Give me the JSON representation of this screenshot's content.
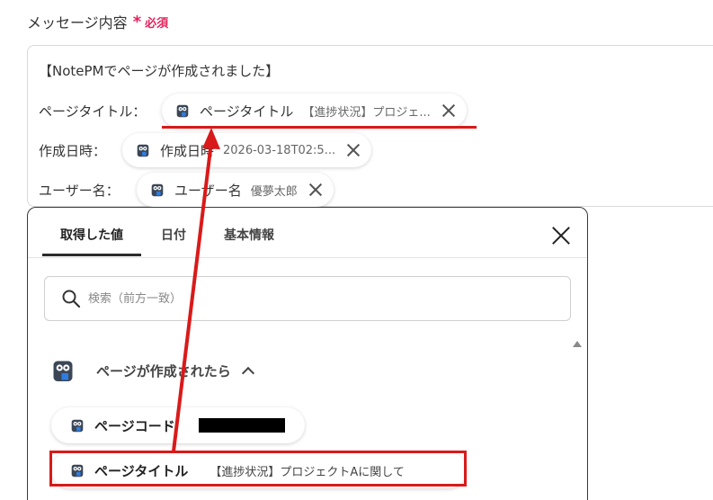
{
  "field": {
    "label": "メッセージ内容",
    "required_star": "*",
    "required_text": "必須"
  },
  "message": {
    "line1": "【NotePMでページが作成されました】",
    "line2_label": "ページタイトル：",
    "line3_label": "作成日時：",
    "line4_label": "ユーザー名："
  },
  "chips": [
    {
      "title": "ページタイトル",
      "value": "【進捗状況】プロジェ..."
    },
    {
      "title": "作成日時",
      "value": "2026-03-18T02:5..."
    },
    {
      "title": "ユーザー名",
      "value": "優夢太郎"
    }
  ],
  "panel": {
    "tabs": [
      {
        "label": "取得した値",
        "active": true
      },
      {
        "label": "日付",
        "active": false
      },
      {
        "label": "基本情報",
        "active": false
      }
    ],
    "search_placeholder": "検索（前方一致）",
    "group_title": "ページが作成されたら",
    "items": [
      {
        "title": "ページコード",
        "value_redacted": true
      },
      {
        "title": "ページタイトル",
        "value": "【進捗状況】プロジェクトAに関して"
      }
    ]
  },
  "colors": {
    "required": "#e0245e",
    "highlight": "#d91a1a"
  },
  "icons": {
    "app": "owl-icon",
    "search": "search-icon",
    "close": "close-icon",
    "collapse": "chevron-up-icon"
  }
}
